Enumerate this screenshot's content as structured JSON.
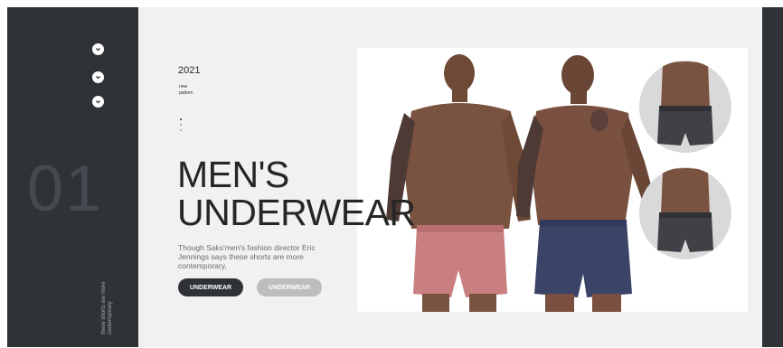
{
  "hero": {
    "slide_number": "01",
    "side_caption": "these shorts are more contemporary",
    "year": "2021",
    "subtitle_line1": "new",
    "subtitle_line2": "pattern",
    "headline_line1": "MEN'S",
    "headline_line2": "UNDERWEAR",
    "description": "Though Saks'men's fashion director Eric Jennings says these shorts are more contemporary,",
    "primary_button_label": "UNDERWEAR",
    "secondary_button_label": "UNDERWEAR"
  },
  "nav": {
    "icons": [
      "chevron-down-icon",
      "chevron-down-icon",
      "chevron-down-icon"
    ]
  },
  "colors": {
    "sidebar": "#2f3237",
    "background": "#f1f1f1",
    "pink_shorts": "#c97f80",
    "navy_shorts": "#3b4467",
    "charcoal_shorts": "#3f4146"
  }
}
